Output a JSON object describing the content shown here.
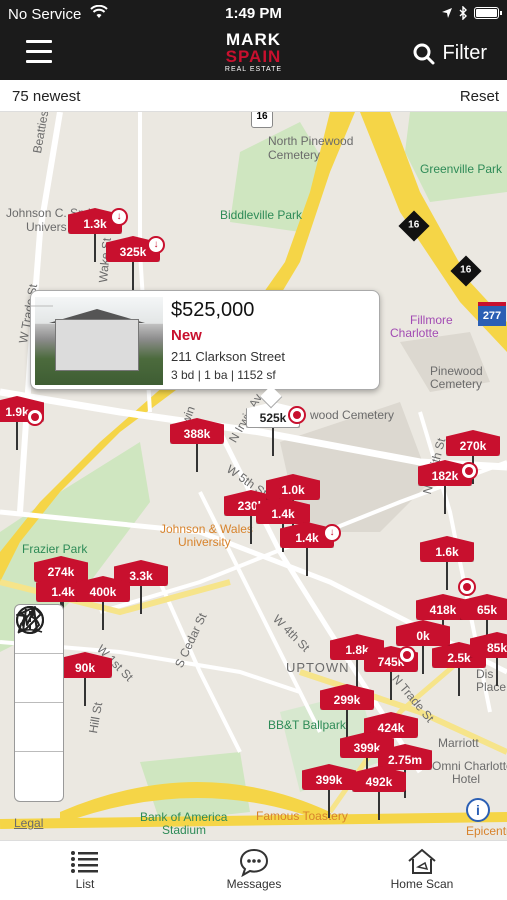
{
  "status": {
    "carrier": "No Service",
    "time": "1:49 PM"
  },
  "nav": {
    "logo_line1": "MARK",
    "logo_line2": "SPAIN",
    "logo_line3": "REAL ESTATE",
    "filter_label": "Filter"
  },
  "subbar": {
    "count_label": "75 newest",
    "reset_label": "Reset"
  },
  "map": {
    "labels": {
      "north_pinewood": "North Pinewood",
      "cemetery1": "Cemetery",
      "biddleville": "Biddleville Park",
      "greenville": "Greenville Park",
      "johnson": "Johnson C. Smith",
      "univers": "Univers",
      "fillmore": "Fillmore",
      "charlotte": "Charlotte",
      "pinewood": "Pinewood",
      "cemetery2": "Cemetery",
      "wood_cemetery": "wood Cemetery",
      "jw1": "Johnson & Wales",
      "jw2": "University",
      "frazier": "Frazier Park",
      "uptown": "UPTOWN",
      "bbt": "BB&T Ballpark",
      "marriott": "Marriott",
      "omni1": "Omni Charlotte",
      "omni2": "Hotel",
      "boa1": "Bank of America",
      "boa2": "Stadium",
      "toastery": "Famous Toastery",
      "epicentre": "Epicentr",
      "legal": "Legal",
      "beatties": "Beatties Ford Rd",
      "wtrade": "W Trade St",
      "wake": "Wake St",
      "irwin": "N Irwin Av",
      "w5th": "W 5th St",
      "w4th": "W 4th St",
      "scedar": "S Cedar St",
      "w1st": "W 1st St",
      "hill": "Hill St",
      "ntrade": "N Trade St",
      "nsmith": "N Smith St",
      "dis": "Dis",
      "place": "Place",
      "shield16a": "16",
      "shield16b": "16",
      "shield16c": "16",
      "shield277": "277",
      "irwin2": "Irwin"
    },
    "pins": [
      {
        "label": "1.3k"
      },
      {
        "label": "325k"
      },
      {
        "label": "1.9k"
      },
      {
        "label": "388k"
      },
      {
        "label": "525k"
      },
      {
        "label": "230k"
      },
      {
        "label": "1.0k"
      },
      {
        "label": "1.4k"
      },
      {
        "label": "1.4k"
      },
      {
        "label": "274k"
      },
      {
        "label": "3.3k"
      },
      {
        "label": "1.4k"
      },
      {
        "label": "400k"
      },
      {
        "label": "270k"
      },
      {
        "label": "182k"
      },
      {
        "label": "1.6k"
      },
      {
        "label": "418k"
      },
      {
        "label": "65k"
      },
      {
        "label": "2.5k"
      },
      {
        "label": "1.8k"
      },
      {
        "label": "745k"
      },
      {
        "label": "0k"
      },
      {
        "label": "299k"
      },
      {
        "label": "424k"
      },
      {
        "label": "399k"
      },
      {
        "label": "2.75m"
      },
      {
        "label": "399k"
      },
      {
        "label": "492k"
      },
      {
        "label": "90k"
      },
      {
        "label": "85k"
      }
    ]
  },
  "popup": {
    "price": "$525,000",
    "status": "New",
    "address": "211 Clarkson Street",
    "specs": "3 bd | 1 ba | 1152 sf"
  },
  "tabs": {
    "list": "List",
    "messages": "Messages",
    "home_scan": "Home Scan"
  },
  "colors": {
    "brand": "#c8102e",
    "navbar": "#1b1b1b",
    "highway": "#f5d547"
  }
}
